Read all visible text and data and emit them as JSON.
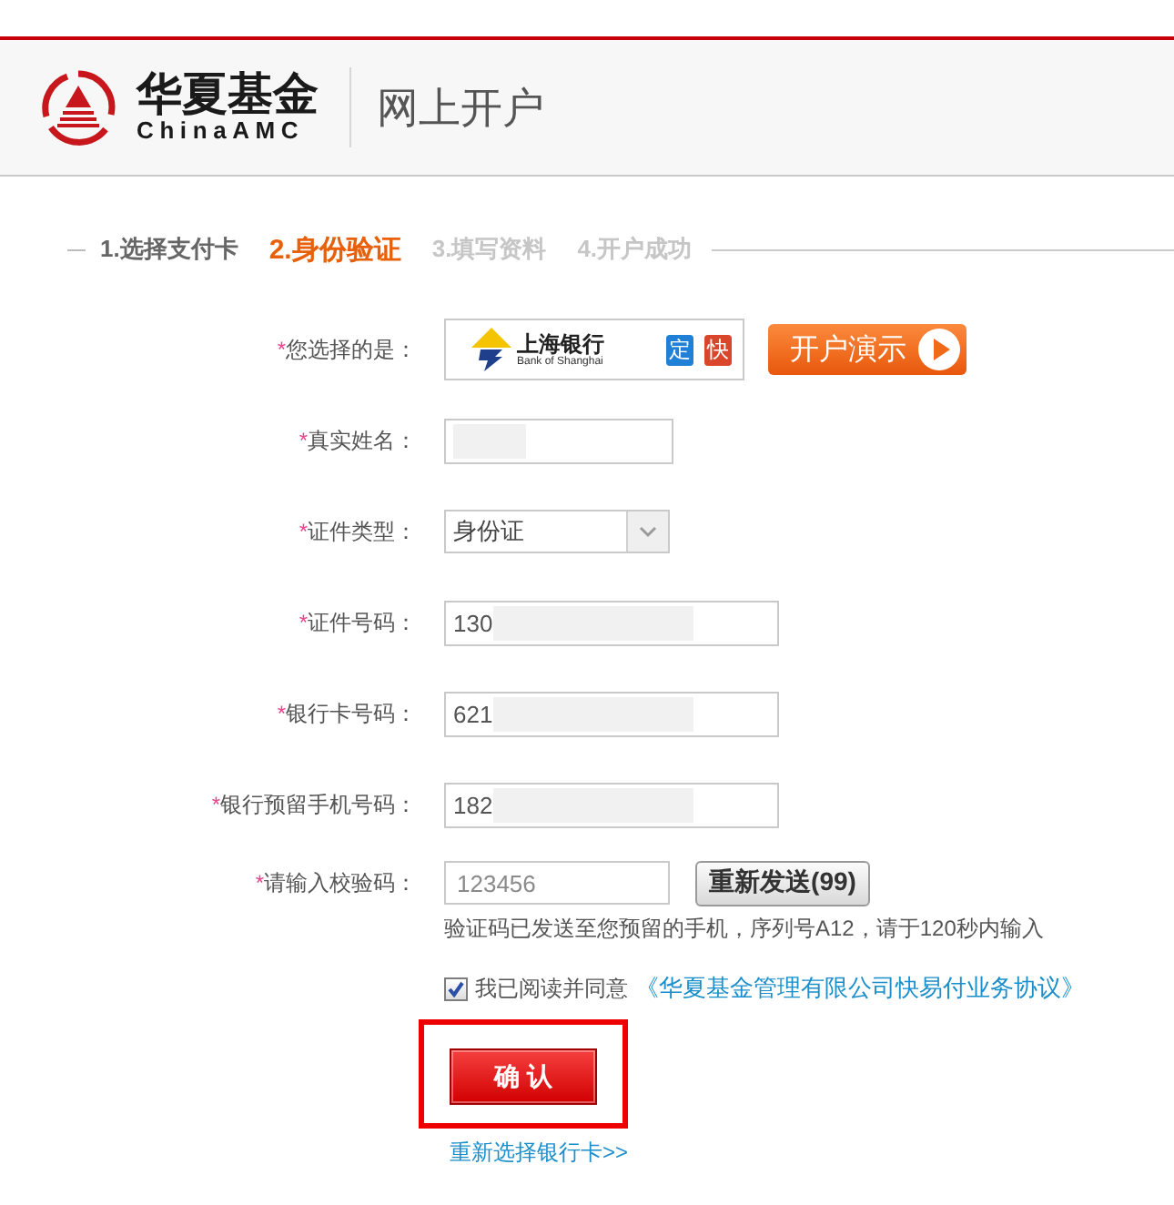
{
  "header": {
    "logo": {
      "name_cn": "华夏基金",
      "name_en": "ChinaAMC"
    },
    "title": "网上开户"
  },
  "steps": [
    {
      "label": "1.选择支付卡",
      "done": true,
      "selected": false
    },
    {
      "label": "2.身份验证",
      "done": false,
      "selected": true
    },
    {
      "label": "3.填写资料",
      "done": false,
      "selected": false
    },
    {
      "label": "4.开户成功",
      "done": false,
      "selected": false
    }
  ],
  "form": {
    "fields": [
      {
        "kind": "bank",
        "required_mark": "*",
        "label": "您选择的是：",
        "bank": {
          "name": "上海银行",
          "name_en": "Bank of Shanghai"
        },
        "badges": [
          {
            "label": "定",
            "color": "#1f80d6"
          },
          {
            "label": "快",
            "color": "#d9462c"
          }
        ],
        "action": "开户演示"
      },
      {
        "kind": "short_text",
        "required_mark": "*",
        "label": "真实姓名：",
        "redacted": true
      },
      {
        "kind": "select",
        "required_mark": "*",
        "label": "证件类型：",
        "value": "身份证"
      },
      {
        "kind": "text",
        "required_mark": "*",
        "label": "证件号码：",
        "value": "130",
        "redacted": true
      },
      {
        "kind": "text",
        "required_mark": "*",
        "label": "银行卡号码：",
        "value": "621",
        "redacted": true
      },
      {
        "kind": "text",
        "required_mark": "*",
        "label": "银行预留手机号码：",
        "value": "182",
        "redacted": true
      },
      {
        "kind": "code",
        "required_mark": "*",
        "label": "请输入校验码：",
        "placeholder": "123456",
        "action": "重新发送(99)"
      }
    ],
    "hint": "验证码已发送至您预留的手机，序列号A12，请于120秒内输入",
    "agreement": {
      "checked": true,
      "text": "我已阅读并同意",
      "link": "《华夏基金管理有限公司快易付业务协议》"
    },
    "submit": {
      "label": "确 认",
      "highlighted": true
    },
    "reselect_link": "重新选择银行卡>>"
  }
}
